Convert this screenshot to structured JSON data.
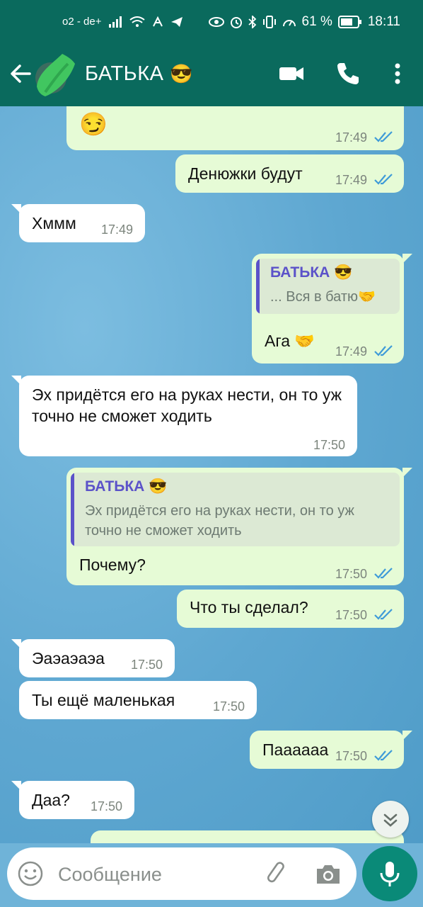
{
  "status_bar": {
    "carrier": "o2 - de+",
    "battery": "61 %",
    "time": "18:11"
  },
  "header": {
    "title": "БАТЬКА",
    "title_emoji": "😎",
    "icons": [
      "back-arrow-icon",
      "video-call-icon",
      "phone-icon",
      "more-vert-icon"
    ]
  },
  "messages": [
    {
      "dir": "out",
      "text": "😏",
      "time": "17:49",
      "status": "read"
    },
    {
      "dir": "out",
      "text": "Денюжки будут",
      "time": "17:49",
      "status": "read"
    },
    {
      "dir": "in",
      "text": "Хммм",
      "time": "17:49"
    },
    {
      "dir": "out",
      "text": "Ага 🤝",
      "time": "17:49",
      "status": "read",
      "reply": {
        "author": "БАТЬКА 😎",
        "text": "... Вся в батю🤝"
      }
    },
    {
      "dir": "in",
      "text": "Эх придётся его на руках нести, он то уж точно не сможет ходить",
      "time": "17:50"
    },
    {
      "dir": "out",
      "text": "Почему?",
      "time": "17:50",
      "status": "read",
      "reply": {
        "author": "БАТЬКА 😎",
        "text": "Эх придётся его на руках нести, он то уж точно не сможет ходить"
      }
    },
    {
      "dir": "out",
      "text": "Что ты сделал?",
      "time": "17:50",
      "status": "read"
    },
    {
      "dir": "in",
      "text": "Эаэаэаэа",
      "time": "17:50"
    },
    {
      "dir": "in",
      "text": "Ты ещё маленькая",
      "time": "17:50"
    },
    {
      "dir": "out",
      "text": "Паааааа",
      "time": "17:50",
      "status": "read"
    },
    {
      "dir": "in",
      "text": "Даа?",
      "time": "17:50"
    }
  ],
  "composer": {
    "placeholder": "Сообщение"
  },
  "colors": {
    "header": "#0a6a5d",
    "outgoing_bubble": "#e6fbd6",
    "incoming_bubble": "#ffffff",
    "read_ticks": "#3f9bd8",
    "mic_button": "#0a8a78"
  }
}
